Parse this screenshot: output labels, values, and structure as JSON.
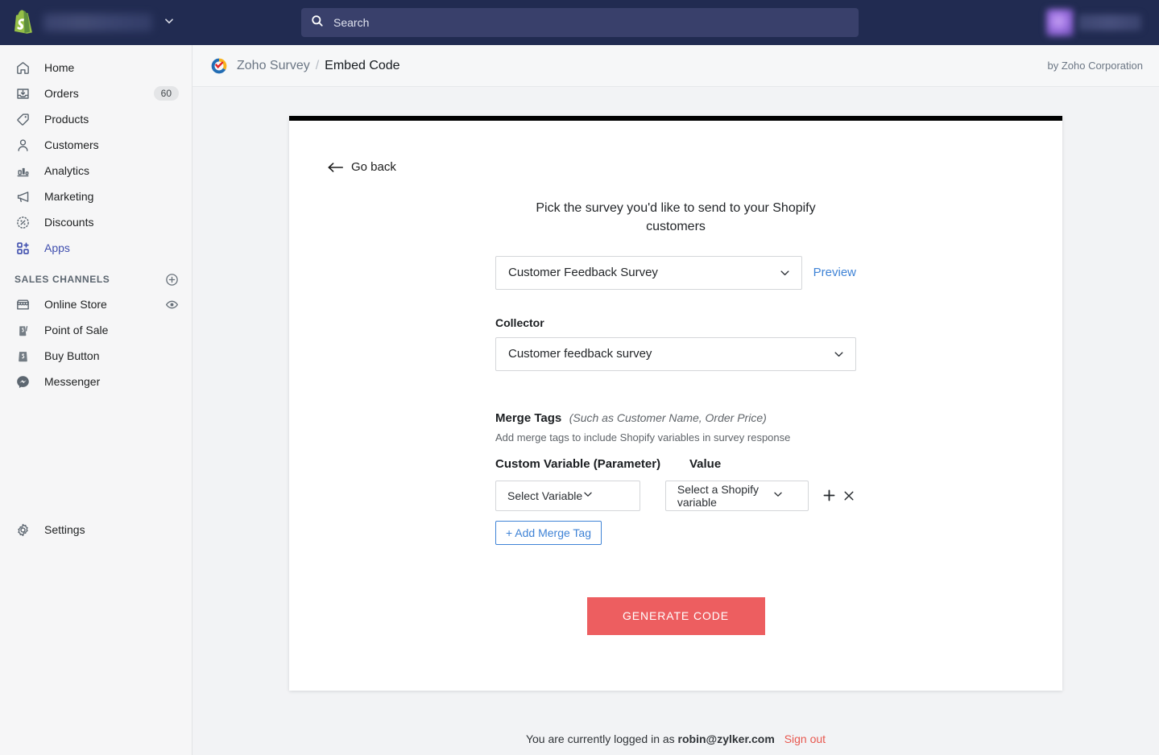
{
  "topbar": {
    "logo_icon": "shopify-bag-icon",
    "store_name": "",
    "store_chevron_icon": "chevron-down-icon",
    "search": {
      "icon": "search-icon",
      "placeholder": "Search",
      "value": ""
    },
    "account": {
      "avatar": "",
      "name": ""
    }
  },
  "sidebar": {
    "items": [
      {
        "label": "Home",
        "icon": "home-icon",
        "badge": "",
        "active": false
      },
      {
        "label": "Orders",
        "icon": "orders-inbox-icon",
        "badge": "60",
        "active": false
      },
      {
        "label": "Products",
        "icon": "tag-icon",
        "badge": "",
        "active": false
      },
      {
        "label": "Customers",
        "icon": "person-icon",
        "badge": "",
        "active": false
      },
      {
        "label": "Analytics",
        "icon": "bar-chart-icon",
        "badge": "",
        "active": false
      },
      {
        "label": "Marketing",
        "icon": "megaphone-icon",
        "badge": "",
        "active": false
      },
      {
        "label": "Discounts",
        "icon": "discount-percent-icon",
        "badge": "",
        "active": false
      },
      {
        "label": "Apps",
        "icon": "apps-grid-plus-icon",
        "badge": "",
        "active": true
      }
    ],
    "section": {
      "title": "SALES CHANNELS",
      "add_icon": "plus-circle-icon"
    },
    "channels": [
      {
        "label": "Online Store",
        "icon": "storefront-icon",
        "trailing_icon": "eye-icon"
      },
      {
        "label": "Point of Sale",
        "icon": "pos-bag-icon",
        "trailing_icon": ""
      },
      {
        "label": "Buy Button",
        "icon": "buy-button-bag-icon",
        "trailing_icon": ""
      },
      {
        "label": "Messenger",
        "icon": "messenger-icon",
        "trailing_icon": ""
      }
    ],
    "settings": {
      "label": "Settings",
      "icon": "gear-icon"
    }
  },
  "app_header": {
    "logo_icon": "zoho-survey-logo-icon",
    "app_name": "Zoho Survey",
    "separator": "/",
    "current_page": "Embed Code",
    "vendor": "by Zoho Corporation"
  },
  "main": {
    "go_back": {
      "label": "Go back",
      "icon": "arrow-left-icon"
    },
    "lead_text": "Pick the survey you'd like to send to your Shopify customers",
    "survey_select": {
      "value": "Customer Feedback Survey",
      "chevron_icon": "chevron-down-icon"
    },
    "preview_link": "Preview",
    "collector_label": "Collector",
    "collector_select": {
      "value": "Customer feedback survey",
      "chevron_icon": "chevron-down-icon"
    },
    "merge_tags": {
      "title": "Merge Tags",
      "title_hint": "(Such as Customer Name, Order Price)",
      "subtitle": "Add merge tags to include Shopify variables in survey response",
      "col_variable": "Custom Variable (Parameter)",
      "col_value": "Value",
      "variable_select": {
        "value": "Select Variable",
        "chevron_icon": "chevron-down-icon"
      },
      "shopify_select": {
        "value": "Select a Shopify variable",
        "chevron_icon": "chevron-down-icon"
      },
      "add_row_icon": "plus-icon",
      "remove_row_icon": "close-x-icon",
      "add_button": "+ Add Merge Tag"
    },
    "generate_button": "GENERATE CODE"
  },
  "footer": {
    "text_before": "You are currently logged in as",
    "email": "robin@zylker.com",
    "sign_out": "Sign out"
  },
  "colors": {
    "topbar_bg": "#212b51",
    "accent_blue": "#3f83d6",
    "active_nav": "#3f4eae",
    "generate_btn": "#ed5e60",
    "sign_out": "#e8584f",
    "page_bg": "#f2f3f5"
  }
}
